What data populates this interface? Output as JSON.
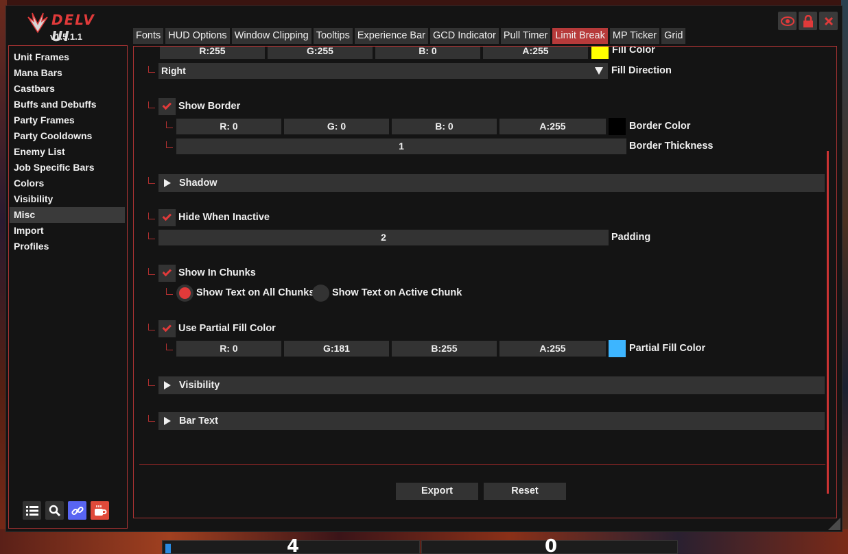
{
  "app": {
    "logo_text": "DELV",
    "logo_ui": "UI",
    "version": "v1.5.1.1"
  },
  "top_icons": [
    "eye-icon",
    "lock-icon",
    "close-icon"
  ],
  "tabs": [
    {
      "label": "Fonts"
    },
    {
      "label": "HUD Options"
    },
    {
      "label": "Window Clipping"
    },
    {
      "label": "Tooltips"
    },
    {
      "label": "Experience Bar"
    },
    {
      "label": "GCD Indicator"
    },
    {
      "label": "Pull Timer"
    },
    {
      "label": "Limit Break",
      "active": true
    },
    {
      "label": "MP Ticker"
    },
    {
      "label": "Grid"
    }
  ],
  "sidebar": {
    "items": [
      {
        "label": "Unit Frames"
      },
      {
        "label": "Mana Bars"
      },
      {
        "label": "Castbars"
      },
      {
        "label": "Buffs and Debuffs"
      },
      {
        "label": "Party Frames"
      },
      {
        "label": "Party Cooldowns"
      },
      {
        "label": "Enemy List"
      },
      {
        "label": "Job Specific Bars"
      },
      {
        "label": "Colors"
      },
      {
        "label": "Visibility"
      },
      {
        "label": "Misc",
        "active": true
      },
      {
        "label": "Import"
      },
      {
        "label": "Profiles"
      }
    ],
    "buttons": [
      "list-icon",
      "search-icon",
      "link-icon",
      "coffee-icon"
    ]
  },
  "main": {
    "fill_color": {
      "r": "R:255",
      "g": "G:255",
      "b": "B: 0",
      "a": "A:255",
      "label": "Fill Color",
      "color": "#ffff00"
    },
    "fill_direction": {
      "value": "Right",
      "label": "Fill Direction"
    },
    "show_border": {
      "label": "Show Border",
      "checked": true
    },
    "border_color": {
      "r": "R: 0",
      "g": "G: 0",
      "b": "B: 0",
      "a": "A:255",
      "label": "Border Color",
      "color": "#000000"
    },
    "border_thickness": {
      "value": "1",
      "label": "Border Thickness"
    },
    "shadow": {
      "label": "Shadow"
    },
    "hide_when_inactive": {
      "label": "Hide When Inactive",
      "checked": true
    },
    "padding": {
      "value": "2",
      "label": "Padding"
    },
    "show_in_chunks": {
      "label": "Show In Chunks",
      "checked": true
    },
    "chunk_text": {
      "option_all": "Show Text on All Chunks",
      "option_active": "Show Text on Active Chunk",
      "selected": "all"
    },
    "use_partial_fill": {
      "label": "Use Partial Fill Color",
      "checked": true
    },
    "partial_fill_color": {
      "r": "R: 0",
      "g": "G:181",
      "b": "B:255",
      "a": "A:255",
      "label": "Partial Fill Color",
      "color": "#3db5ff"
    },
    "visibility": {
      "label": "Visibility"
    },
    "bar_text": {
      "label": "Bar Text"
    },
    "export_label": "Export",
    "reset_label": "Reset"
  },
  "hud": {
    "left_number": "4",
    "right_number": "0"
  },
  "colors": {
    "accent": "#b73a3a",
    "check": "#e23a3a",
    "link_button": "#5865f2",
    "coffee_button": "#e04a3a"
  }
}
